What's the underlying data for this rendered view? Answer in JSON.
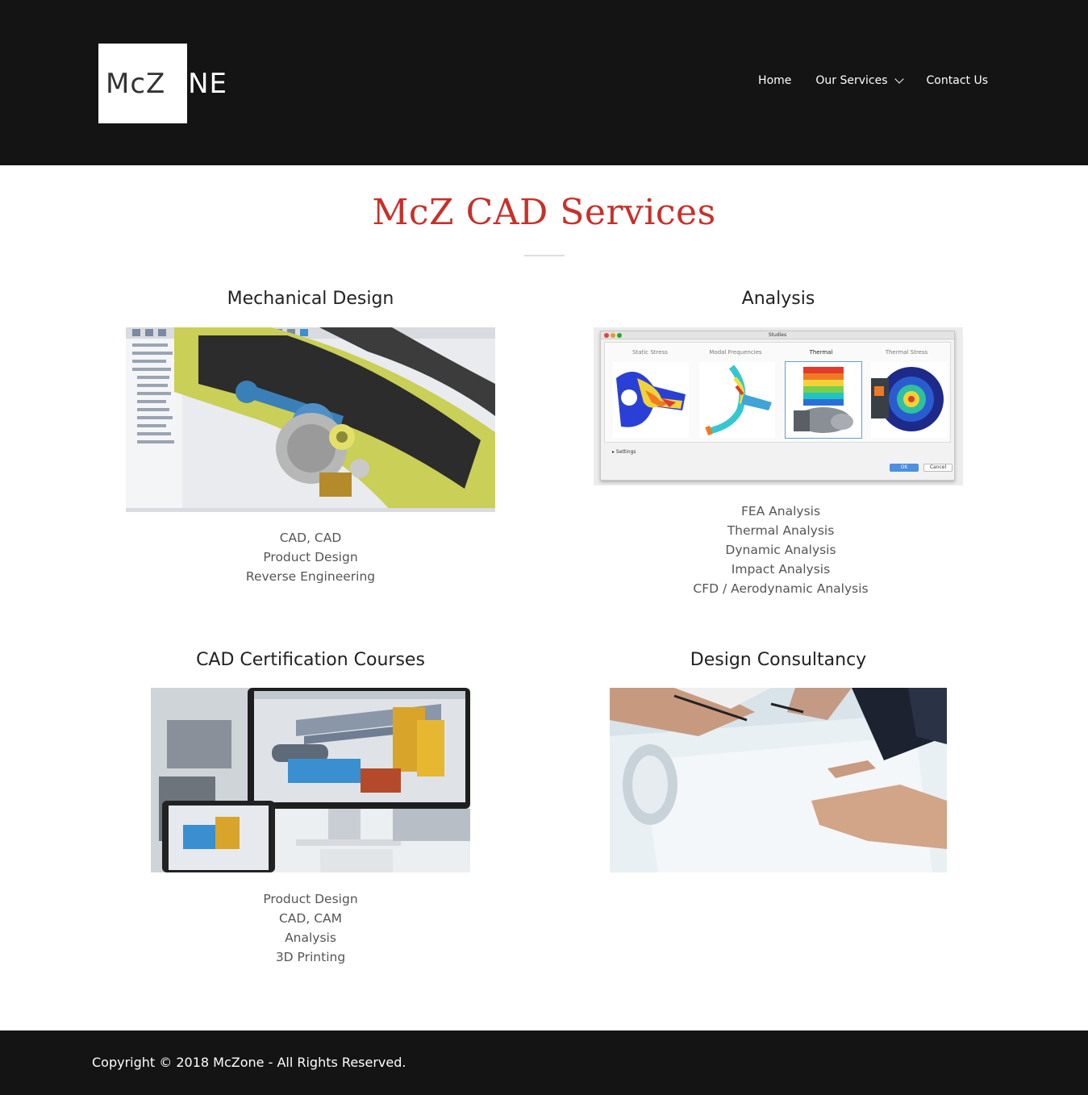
{
  "header": {
    "logo": {
      "text_dark": "McZ",
      "text_light": "ONE"
    },
    "nav": [
      {
        "label": "Home"
      },
      {
        "label": "Our Services"
      },
      {
        "label": "Contact Us"
      }
    ]
  },
  "main": {
    "title": "McZ CAD Services",
    "services": [
      {
        "title": "Mechanical Design",
        "items": [
          "CAD, CAD",
          "Product Design",
          "Reverse Engineering"
        ]
      },
      {
        "title": "Analysis",
        "items": [
          "FEA Analysis",
          "Thermal Analysis",
          "Dynamic Analysis",
          "Impact Analysis",
          "CFD / Aerodynamic Analysis"
        ],
        "studies_window": {
          "title": "Studies",
          "tabs": [
            "Static Stress",
            "Modal Frequencies",
            "Thermal",
            "Thermal Stress"
          ],
          "settings_label": "Settings",
          "ok_label": "OK",
          "cancel_label": "Cancel"
        }
      },
      {
        "title": "CAD Certification Courses",
        "items": [
          "Product Design",
          "CAD, CAM",
          "Analysis",
          "3D Printing"
        ]
      },
      {
        "title": "Design Consultancy",
        "items": []
      }
    ]
  },
  "footer": {
    "copyright": "Copyright © 2018 McZone - All Rights Reserved."
  },
  "colors": {
    "header_bg": "#141414",
    "title_red": "#c8302a",
    "text_gray": "#555555"
  }
}
